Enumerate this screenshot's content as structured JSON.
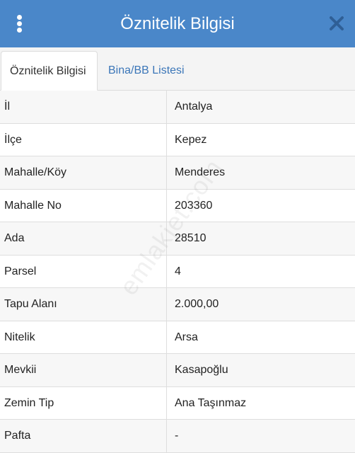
{
  "header": {
    "title": "Öznitelik Bilgisi",
    "menu_icon": "more-vertical-icon",
    "close_icon": "close-icon",
    "color": "#4a87c9"
  },
  "tabs": [
    {
      "label": "Öznitelik Bilgisi",
      "active": true
    },
    {
      "label": "Bina/BB Listesi",
      "active": false
    }
  ],
  "rows": [
    {
      "label": "İl",
      "value": "Antalya"
    },
    {
      "label": "İlçe",
      "value": "Kepez"
    },
    {
      "label": "Mahalle/Köy",
      "value": "Menderes"
    },
    {
      "label": "Mahalle No",
      "value": "203360"
    },
    {
      "label": "Ada",
      "value": "28510"
    },
    {
      "label": "Parsel",
      "value": "4"
    },
    {
      "label": "Tapu Alanı",
      "value": "2.000,00"
    },
    {
      "label": "Nitelik",
      "value": "Arsa"
    },
    {
      "label": "Mevkii",
      "value": "Kasapoğlu"
    },
    {
      "label": "Zemin Tip",
      "value": "Ana Taşınmaz"
    },
    {
      "label": "Pafta",
      "value": "-"
    }
  ],
  "watermark": "emlakjet.com"
}
